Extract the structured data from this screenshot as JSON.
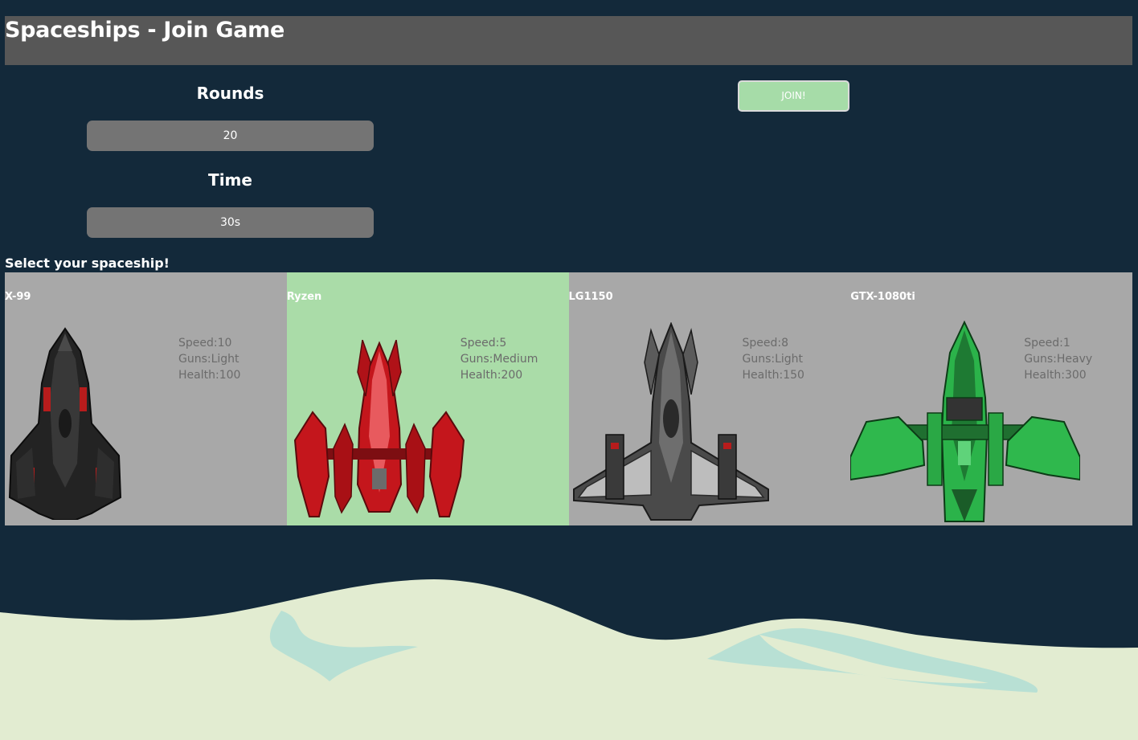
{
  "header": {
    "title": "Spaceships - Join Game"
  },
  "settings": {
    "rounds_label": "Rounds",
    "rounds_value": "20",
    "time_label": "Time",
    "time_value": "30s"
  },
  "join": {
    "label": "JOIN!"
  },
  "ships_section": {
    "title": "Select your spaceship!"
  },
  "ships": [
    {
      "name": "X-99",
      "speed": "Speed:10",
      "guns": "Guns:Light",
      "health": "Health:100",
      "selected": false,
      "color": "#2a2a2a"
    },
    {
      "name": "Ryzen",
      "speed": "Speed:5",
      "guns": "Guns:Medium",
      "health": "Health:200",
      "selected": true,
      "color": "#c0151c"
    },
    {
      "name": "LG1150",
      "speed": "Speed:8",
      "guns": "Guns:Light",
      "health": "Health:150",
      "selected": false,
      "color": "#3d3d3d"
    },
    {
      "name": "GTX-1080ti",
      "speed": "Speed:1",
      "guns": "Guns:Heavy",
      "health": "Health:300",
      "selected": false,
      "color": "#21a83a"
    }
  ],
  "colors": {
    "background": "#13293a",
    "header": "#575757",
    "input": "#747474",
    "join_button": "#a6dca8",
    "card": "#a8a8a8",
    "card_selected": "#aadca8",
    "terrain": "#e2ecd1",
    "water": "#b8e0d4"
  }
}
